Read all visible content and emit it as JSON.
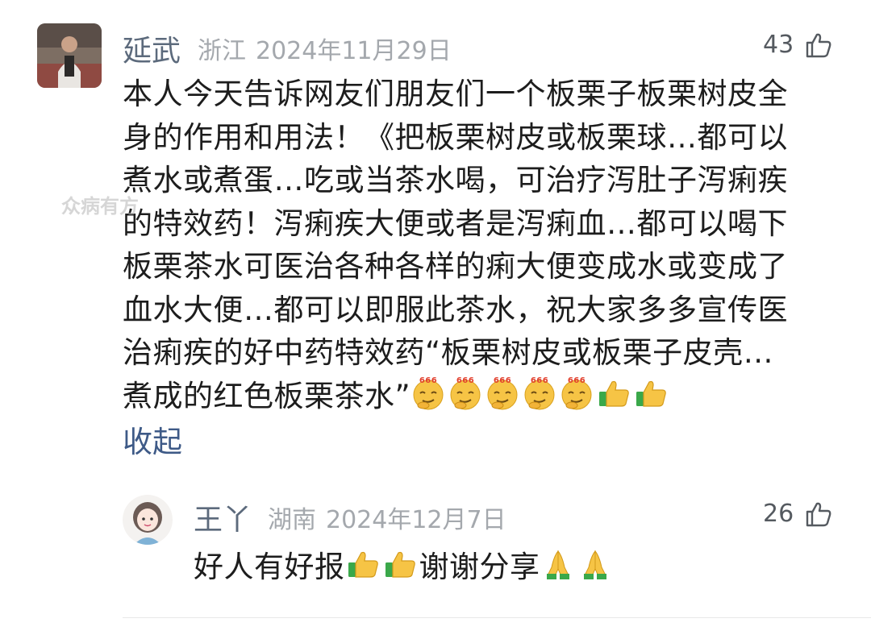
{
  "comments": [
    {
      "author": "延武",
      "location": "浙江",
      "date": "2024年11月29日",
      "likes": "43",
      "lines": [
        "本人今天告诉网友们朋友们一个板栗子板栗树皮全",
        "身的作用和用法！《把板栗树皮或板栗球…都可以",
        "煮水或煮蛋…吃或当茶水喝，可治疗泻肚子泻痢疾",
        "的特效药！泻痢疾大便或者是泻痢血…都可以喝下",
        "板栗茶水可医治各种各样的痢大便变成水或变成了",
        "血水大便…都可以即服此茶水，祝大家多多宣传医",
        "治痢疾的好中药特效药“板栗树皮或板栗子皮壳…"
      ],
      "last_line": "煮成的红色板栗茶水”",
      "emojis": [
        "666-emoji",
        "666-emoji",
        "666-emoji",
        "666-emoji",
        "666-emoji",
        "thumbs-up-emoji",
        "thumbs-up-emoji"
      ],
      "collapse_label": "收起"
    },
    {
      "author": "王丫",
      "location": "湖南",
      "date": "2024年12月7日",
      "likes": "26",
      "text_parts": [
        "好人有好报",
        "谢谢分享"
      ],
      "emojis_after_first": [
        "thumbs-up-emoji",
        "thumbs-up-emoji"
      ],
      "emojis_after_second": [
        "praying-hands-emoji",
        "praying-hands-emoji"
      ]
    }
  ],
  "watermark": "众病有方",
  "icons": {
    "like": "thumbs-up-outline-icon"
  },
  "colors": {
    "author": "#5c6a7c",
    "meta": "#a4a8ad",
    "link": "#3e5a87",
    "text": "#1d1d1d"
  }
}
